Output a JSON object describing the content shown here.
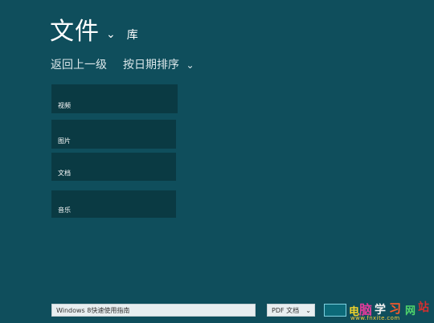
{
  "header": {
    "title": "文件",
    "title_dropdown_icon": "chevron-down-icon",
    "location": "库"
  },
  "subnav": {
    "back": "返回上一级",
    "sort": "按日期排序",
    "sort_dropdown_icon": "chevron-down-icon"
  },
  "tiles": [
    {
      "label": "视频"
    },
    {
      "label": "图片"
    },
    {
      "label": "文档"
    },
    {
      "label": "音乐"
    }
  ],
  "footer": {
    "filename_value": "Windows 8快速使用指南",
    "filetype_value": "PDF 文档",
    "filetype_dropdown_icon": "chevron-down-icon"
  },
  "watermark": {
    "text": "www.fnxite.com"
  },
  "colors": {
    "background": "#0f4e5c",
    "tile": "#0a3a43",
    "accent": "#7fd2e1"
  }
}
